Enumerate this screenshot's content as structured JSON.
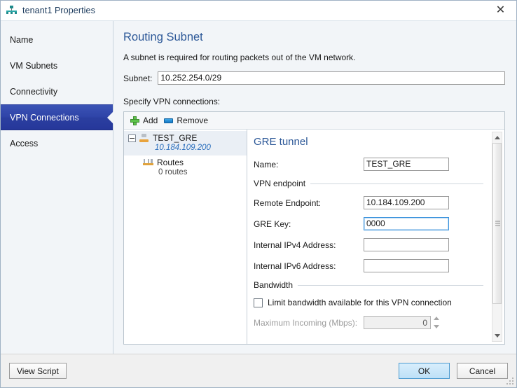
{
  "window": {
    "title": "tenant1 Properties",
    "icon": "network-tenant-icon",
    "close_label": "✕"
  },
  "sidebar": {
    "items": [
      {
        "label": "Name",
        "selected": false
      },
      {
        "label": "VM Subnets",
        "selected": false
      },
      {
        "label": "Connectivity",
        "selected": false
      },
      {
        "label": "VPN Connections",
        "selected": true
      },
      {
        "label": "Access",
        "selected": false
      }
    ]
  },
  "main": {
    "heading": "Routing Subnet",
    "description": "A subnet is required for routing packets out of the VM network.",
    "subnet": {
      "label": "Subnet:",
      "value": "10.252.254.0/29",
      "placeholder": ""
    },
    "specify_label": "Specify VPN connections:",
    "toolbar": {
      "add_label": "Add",
      "add_icon": "plus-icon",
      "remove_label": "Remove",
      "remove_icon": "minus-icon"
    },
    "tree": {
      "nodes": [
        {
          "title": "TEST_GRE",
          "subtitle": "10.184.109.200",
          "icon": "gre-tunnel-icon",
          "expander": "collapse-icon",
          "selected": true
        },
        {
          "title": "Routes",
          "subtitle": "0 routes",
          "icon": "routes-icon",
          "selected": false
        }
      ]
    },
    "detail": {
      "heading": "GRE tunnel",
      "name_field": {
        "label": "Name:",
        "value": "TEST_GRE"
      },
      "vpn_endpoint_group": "VPN endpoint",
      "fields": [
        {
          "label": "Remote Endpoint:",
          "value": "10.184.109.200",
          "focused": false
        },
        {
          "label": "GRE Key:",
          "value": "0000",
          "focused": true
        },
        {
          "label": "Internal IPv4 Address:",
          "value": "",
          "focused": false
        },
        {
          "label": "Internal IPv6 Address:",
          "value": "",
          "focused": false
        }
      ],
      "bandwidth_group": "Bandwidth",
      "limit_checkbox": {
        "label": "Limit bandwidth available for this VPN connection",
        "checked": false
      },
      "max_incoming": {
        "label": "Maximum Incoming (Mbps):",
        "value": "0",
        "disabled": true
      }
    },
    "scrollbar": {
      "up_icon": "scroll-up-icon",
      "down_icon": "scroll-down-icon",
      "grip_icon": "scroll-grip-icon"
    }
  },
  "footer": {
    "view_script_label": "View Script",
    "ok_label": "OK",
    "cancel_label": "Cancel"
  },
  "colors": {
    "accent": "#2b5797",
    "selection": "#2f44a8",
    "primary_button": "#bde0f7",
    "link_italic": "#2b6fbd"
  }
}
